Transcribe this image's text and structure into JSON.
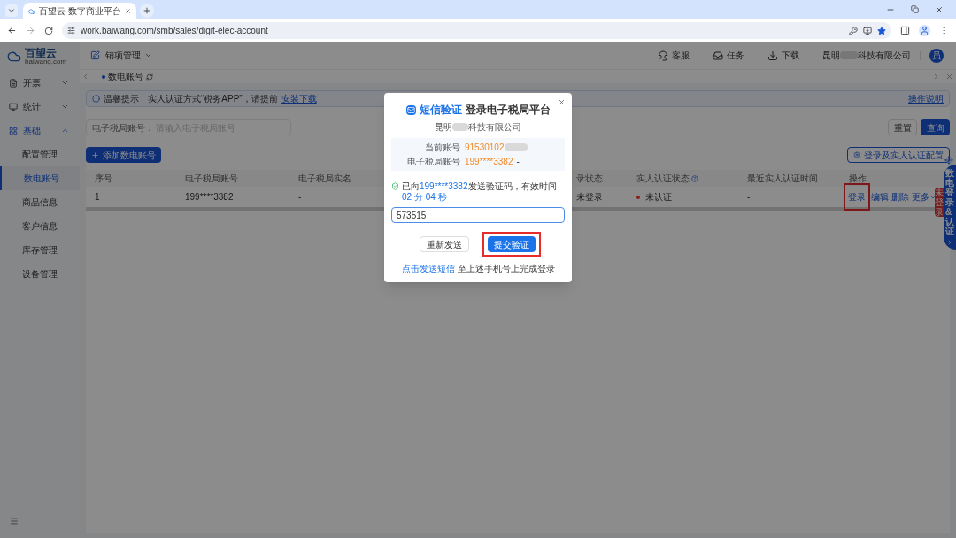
{
  "browser": {
    "tab_title": "百望云-数字商业平台",
    "url": "work.baiwang.com/smb/sales/digit-elec-account"
  },
  "logo": {
    "name": "百望云",
    "domain": "baiwang.com"
  },
  "sidebar": [
    {
      "label": "开票",
      "selected": false,
      "expanded": false
    },
    {
      "label": "统计",
      "selected": false,
      "expanded": false
    },
    {
      "label": "基础",
      "selected": true,
      "expanded": true,
      "children": [
        {
          "label": "配置管理",
          "selected": false
        },
        {
          "label": "数电账号",
          "selected": true
        },
        {
          "label": "商品信息",
          "selected": false
        },
        {
          "label": "客户信息",
          "selected": false
        },
        {
          "label": "库存管理",
          "selected": false
        },
        {
          "label": "设备管理",
          "selected": false
        }
      ]
    }
  ],
  "header": {
    "module": "销项管理",
    "actions": [
      "客服",
      "任务",
      "下载"
    ],
    "company_prefix": "昆明",
    "company_suffix": "科技有限公司",
    "avatar": "员"
  },
  "page_tabs": [
    {
      "label": "数电账号",
      "selected": true
    }
  ],
  "alert": {
    "title": "温馨提示",
    "text": "实人认证方式“税务APP”，请提前",
    "link": "安装下载",
    "help": "操作说明"
  },
  "search": {
    "label": "电子税局账号：",
    "placeholder": "请输入电子税局账号",
    "reset": "重置",
    "query": "查询"
  },
  "add_button": "添加数电账号",
  "config_button": "登录及实人认证配置",
  "table": {
    "columns": [
      {
        "label": "序号"
      },
      {
        "label": "电子税局账号"
      },
      {
        "label": "电子税局实名"
      },
      {
        "label": "录状态"
      },
      {
        "label": "实人认证状态",
        "help": true
      },
      {
        "label": "最近实人认证时间"
      },
      {
        "label": "操作"
      }
    ],
    "rows": [
      {
        "index": "1",
        "account": "199****3382",
        "real_name": "-",
        "login_status": "未登录",
        "auth_status": {
          "label": "未认证",
          "color": "#8b1c1c"
        },
        "last_auth_time": "-",
        "actions": [
          {
            "label": "登录",
            "kind": "link",
            "highlighted": true
          },
          {
            "label": "编辑",
            "kind": "link",
            "highlighted": false
          },
          {
            "label": "删除",
            "kind": "link",
            "highlighted": false
          },
          {
            "label": "更多",
            "kind": "dropdown",
            "highlighted": false
          }
        ]
      }
    ]
  },
  "side_widget": {
    "label": "数电登录&认证",
    "badge": "未登录"
  },
  "dialog": {
    "title_accent": "短信验证",
    "title": "登录电子税局平台",
    "company_prefix": "昆明",
    "company_suffix": "科技有限公司",
    "info": [
      {
        "label": "当前账号",
        "value": "91530102",
        "masked": true
      },
      {
        "label": "电子税局账号",
        "value": "199****3382",
        "suffix": "-"
      }
    ],
    "notice": {
      "prefix": "已向",
      "phone": "199****3382",
      "middle": "发送验证码，有效时间",
      "timer": "02 分 04 秒"
    },
    "code_value": "573515",
    "buttons": [
      {
        "label": "重新发送",
        "kind": "secondary",
        "highlighted": false
      },
      {
        "label": "提交验证",
        "kind": "primary",
        "highlighted": true
      }
    ],
    "footer": {
      "link": "点击发送短信",
      "text": "至上述手机号上完成登录"
    }
  }
}
